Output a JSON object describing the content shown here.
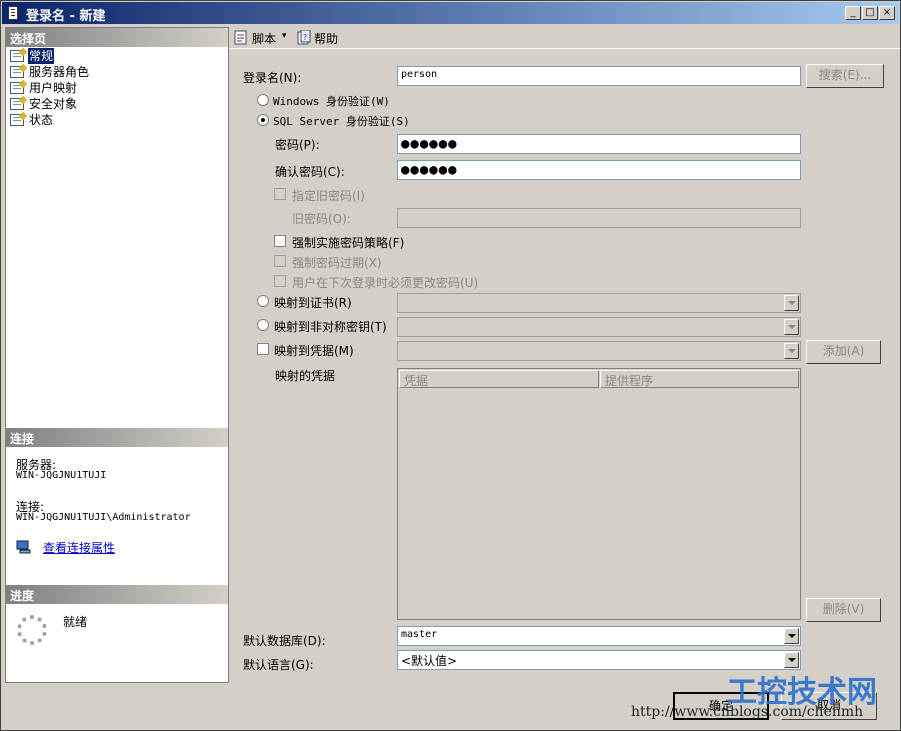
{
  "window": {
    "title": "登录名 - 新建",
    "controls": [
      "_",
      "□",
      "×"
    ]
  },
  "left_panel": {
    "select_page_header": "选择页",
    "pages": [
      {
        "label": "常规",
        "icon": "page-icon",
        "selected": true
      },
      {
        "label": "服务器角色",
        "icon": "page-icon"
      },
      {
        "label": "用户映射",
        "icon": "page-icon"
      },
      {
        "label": "安全对象",
        "icon": "page-icon"
      },
      {
        "label": "状态",
        "icon": "page-icon"
      }
    ],
    "connection_header": "连接",
    "server_label": "服务器:",
    "server_value": "WIN-JQGJNU1TUJI",
    "connection_label": "连接:",
    "connection_value": "WIN-JQGJNU1TUJI\\Administrator",
    "view_connection_link": "查看连接属性",
    "progress_header": "进度",
    "progress_status": "就绪"
  },
  "toolbar": {
    "script_label": "脚本",
    "help_label": "帮助"
  },
  "form": {
    "login_name_label": "登录名(N):",
    "login_name_value": "person",
    "search_button": "搜索(E)...",
    "windows_auth_label": "Windows 身份验证(W)",
    "sql_auth_label": "SQL Server 身份验证(S)",
    "password_label": "密码(P):",
    "password_value": "●●●●●●",
    "confirm_password_label": "确认密码(C):",
    "confirm_password_value": "●●●●●●",
    "specify_old_password_label": "指定旧密码(I)",
    "old_password_label": "旧密码(O):",
    "enforce_policy_label": "强制实施密码策略(F)",
    "enforce_expiration_label": "强制密码过期(X)",
    "must_change_label": "用户在下次登录时必须更改密码(U)",
    "map_certificate_label": "映射到证书(R)",
    "map_asymmetric_label": "映射到非对称密钥(T)",
    "map_credential_label": "映射到凭据(M)",
    "add_button": "添加(A)",
    "mapped_credentials_label": "映射的凭据",
    "grid_columns": [
      "凭据",
      "提供程序"
    ],
    "remove_button": "删除(V)",
    "default_db_label": "默认数据库(D):",
    "default_db_value": "master",
    "default_lang_label": "默认语言(G):",
    "default_lang_value": "<默认值>"
  },
  "footer": {
    "ok_button": "确定",
    "cancel_button": "取消"
  },
  "watermark": {
    "brand": "工控技术网",
    "url": "http://www.cnblogs.com/chenmh"
  }
}
